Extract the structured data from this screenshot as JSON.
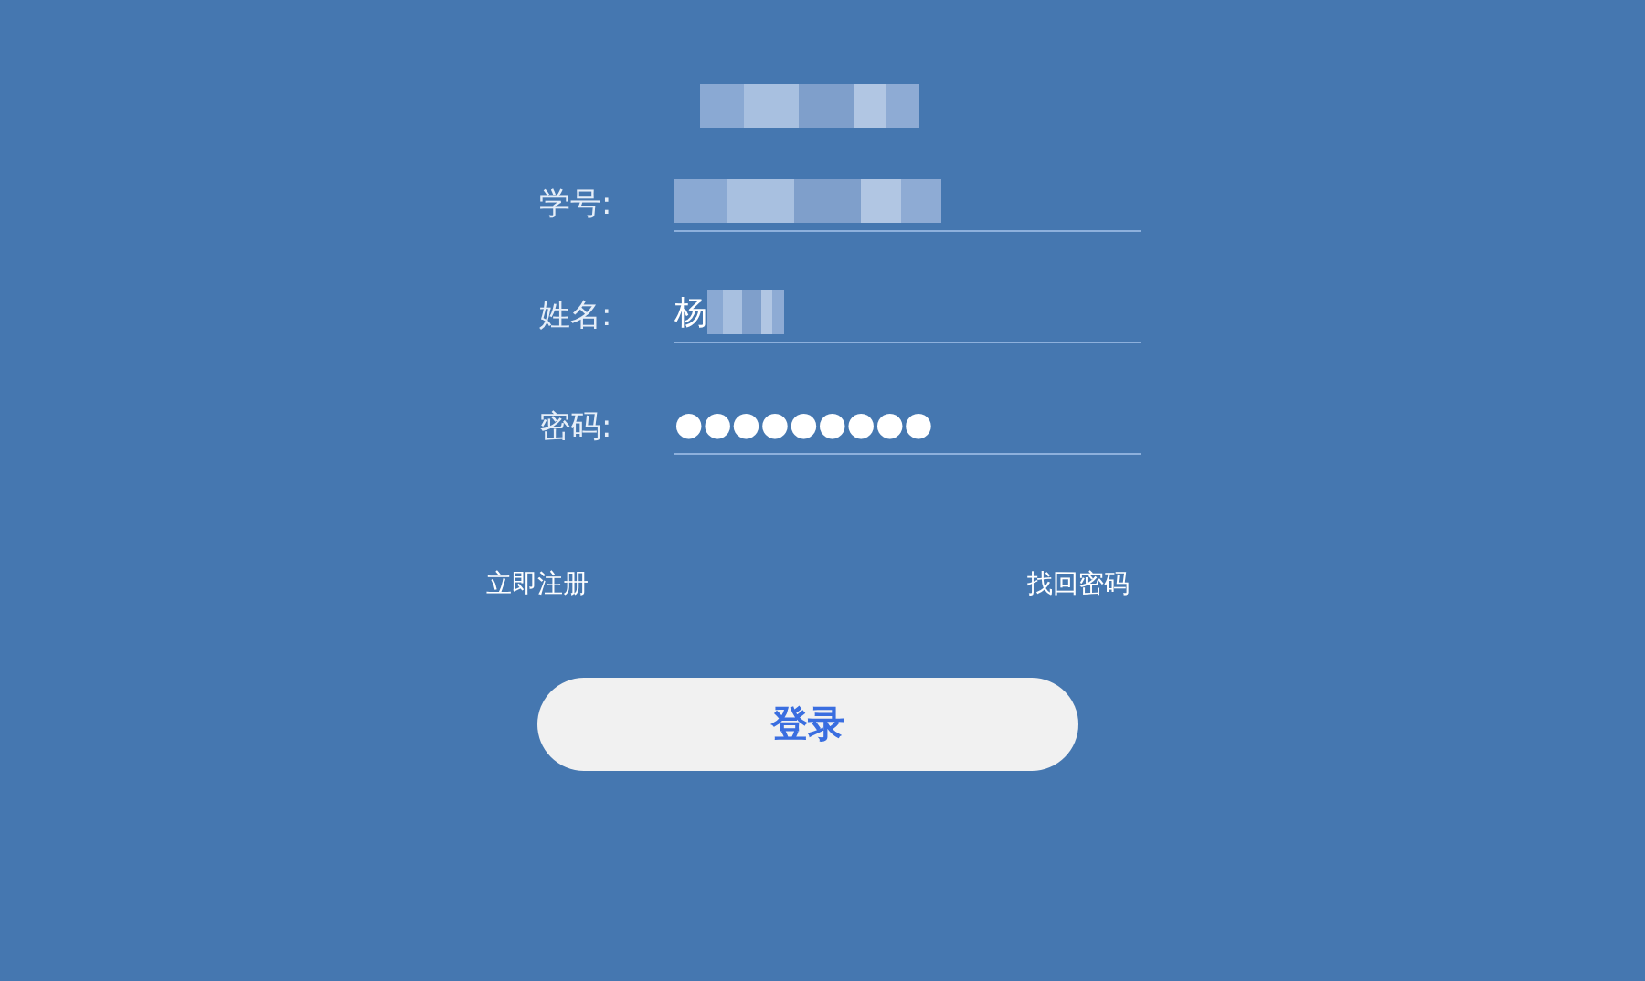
{
  "title": {
    "redacted": true
  },
  "fields": [
    {
      "label": "学号:",
      "redacted": true
    },
    {
      "label": "姓名:",
      "value": "杨",
      "redacted": true
    },
    {
      "label": "密码:",
      "value": "●●●●●●●●●",
      "redacted": false
    }
  ],
  "links": [
    "立即注册",
    "找回密码"
  ],
  "submit_button": "登录"
}
